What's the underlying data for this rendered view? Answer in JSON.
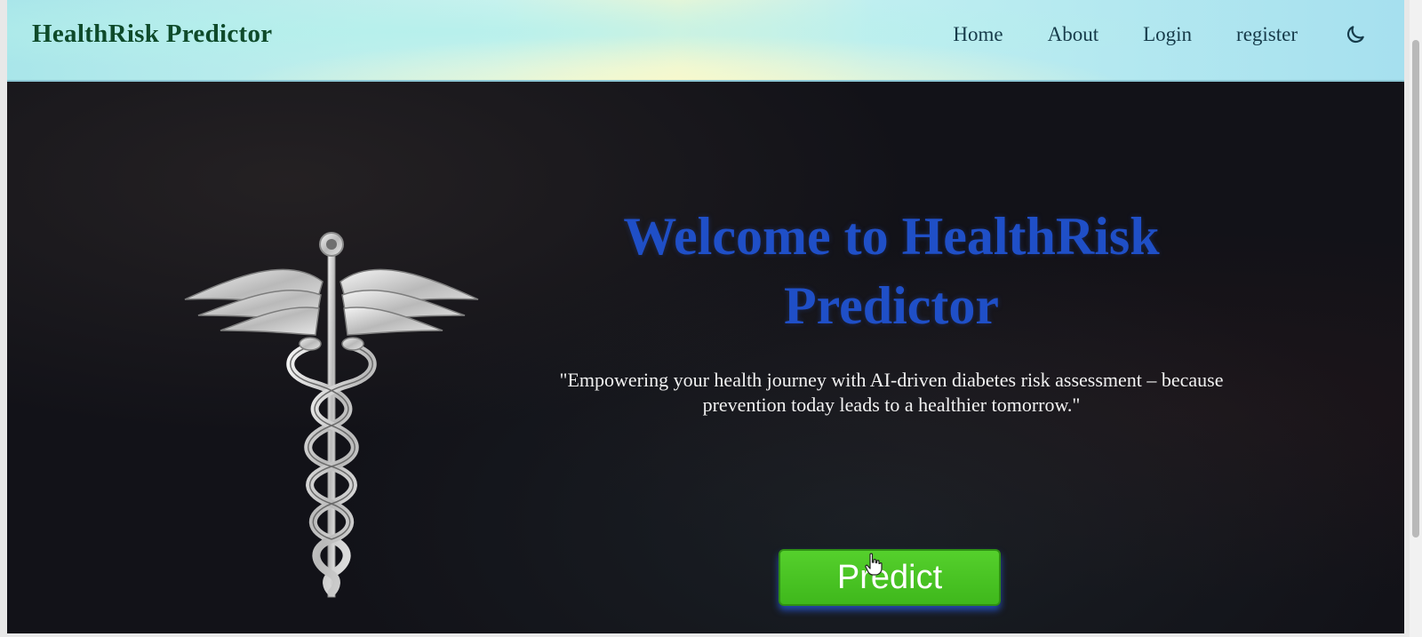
{
  "navbar": {
    "brand": "HealthRisk Predictor",
    "links": [
      "Home",
      "About",
      "Login",
      "register"
    ],
    "theme_toggle_icon": "moon-icon"
  },
  "hero": {
    "title": "Welcome to HealthRisk Predictor",
    "tagline": "\"Empowering your health journey with AI-driven diabetes risk assessment – because prevention today leads to a healthier tomorrow.\"",
    "predict_label": "Predict",
    "image_icon": "caduceus-icon"
  },
  "colors": {
    "navbar_bg": "#bfeff0",
    "hero_bg": "#121218",
    "title_color": "#1f4fc7",
    "brand_color": "#0e4a2a",
    "button_bg": "#4cc824",
    "button_glow": "#2850dc"
  }
}
